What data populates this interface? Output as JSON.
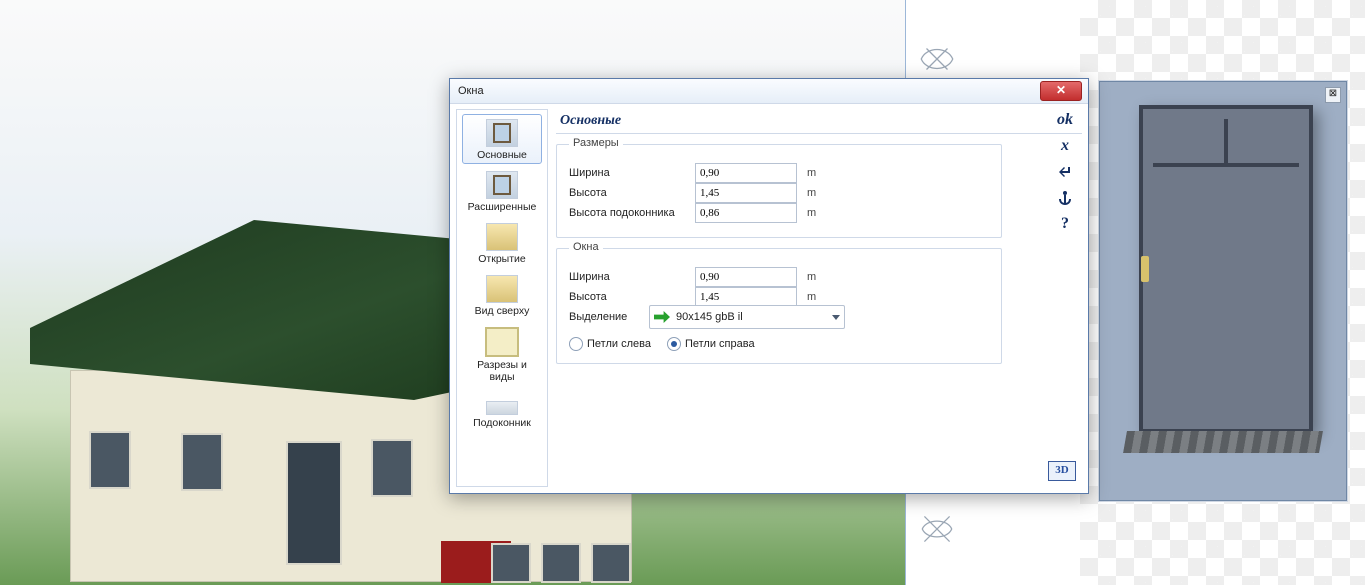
{
  "dialog": {
    "title": "Окна",
    "section_title": "Основные",
    "tabs": [
      {
        "label": "Основные"
      },
      {
        "label": "Расширенные"
      },
      {
        "label": "Открытие"
      },
      {
        "label": "Вид сверху"
      },
      {
        "label": "Разрезы и виды"
      },
      {
        "label": "Подоконник"
      }
    ],
    "group_sizes": {
      "legend": "Размеры",
      "width_label": "Ширина",
      "width_value": "0,90",
      "height_label": "Высота",
      "height_value": "1,45",
      "sill_label": "Высота подоконника",
      "sill_value": "0,86",
      "unit": "m"
    },
    "group_window": {
      "legend": "Окна",
      "width_label": "Ширина",
      "width_value": "0,90",
      "height_label": "Высота",
      "height_value": "1,45",
      "unit": "m",
      "select_label": "Выделение",
      "select_value": "90x145 gbB il",
      "radio_left": "Петли слева",
      "radio_right": "Петли справа",
      "radio_selected": "right"
    },
    "actions": {
      "ok": "ok",
      "cancel": "x",
      "back": "↩",
      "anchor": "⚓",
      "help": "?"
    },
    "close_glyph": "✕"
  },
  "preview": {
    "close_glyph": "⊠",
    "badge3d": "3D"
  }
}
